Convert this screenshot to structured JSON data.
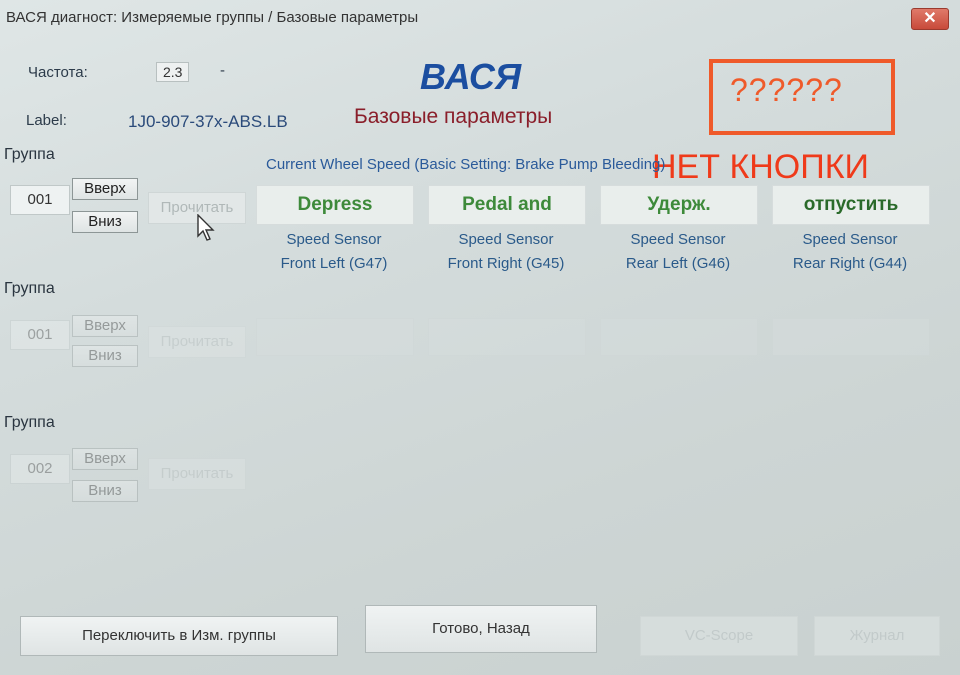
{
  "window": {
    "title": "ВАСЯ диагност: Измеряемые группы / Базовые параметры",
    "close_symbol": "✕",
    "close_icon": "close-icon"
  },
  "info": {
    "freq_label": "Частота:",
    "freq_value": "2.3",
    "freq_suffix": "-",
    "label_label": "Label:",
    "label_value": "1J0-907-37x-ABS.LB"
  },
  "header": {
    "brand": "ВАСЯ",
    "subtitle": "Базовые параметры"
  },
  "annotation": {
    "question": "??????",
    "note": "НЕТ КНОПКИ",
    "color": "#ef5a2a"
  },
  "groups": [
    {
      "label": "Группа",
      "number": "001",
      "up": "Вверх",
      "down": "Вниз",
      "read": "Прочитать",
      "title": "Current Wheel Speed (Basic Setting: Brake Pump Bleeding)",
      "values": [
        "Depress",
        "Pedal and",
        "Удерж.",
        "отпустить"
      ],
      "captions": [
        [
          "Speed Sensor",
          "Front Left (G47)"
        ],
        [
          "Speed Sensor",
          "Front Right (G45)"
        ],
        [
          "Speed Sensor",
          "Rear Left (G46)"
        ],
        [
          "Speed Sensor",
          "Rear Right (G44)"
        ]
      ]
    },
    {
      "label": "Группа",
      "number": "001",
      "up": "Вверх",
      "down": "Вниз",
      "read": "Прочитать"
    },
    {
      "label": "Группа",
      "number": "002",
      "up": "Вверх",
      "down": "Вниз",
      "read": "Прочитать"
    }
  ],
  "footer": {
    "switch": "Переключить в Изм. группы",
    "done_back": "Готово, Назад",
    "vc_scope": "VC-Scope",
    "journal": "Журнал"
  },
  "colors": {
    "brand": "#1b4ea0",
    "subtitle": "#8a1e2a",
    "value_green": "#3d8a3a",
    "caption_blue": "#2a5a8a"
  }
}
